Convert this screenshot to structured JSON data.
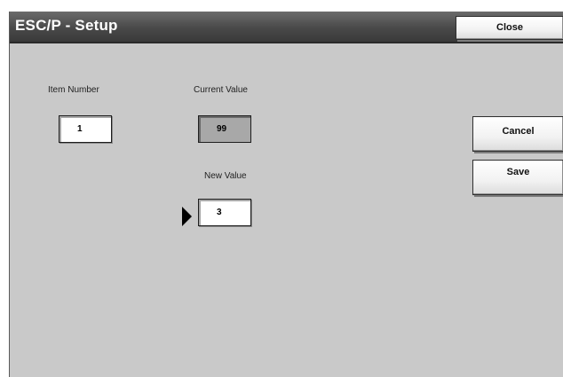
{
  "header": {
    "title": "ESC/P - Setup",
    "close_label": "Close"
  },
  "fields": {
    "item_number_label": "Item Number",
    "item_number_value": "1",
    "current_value_label": "Current Value",
    "current_value": "99",
    "new_value_label": "New Value",
    "new_value": "3"
  },
  "actions": {
    "cancel_label": "Cancel",
    "save_label": "Save"
  },
  "icons": {
    "selection_indicator": "right-triangle-arrow"
  }
}
